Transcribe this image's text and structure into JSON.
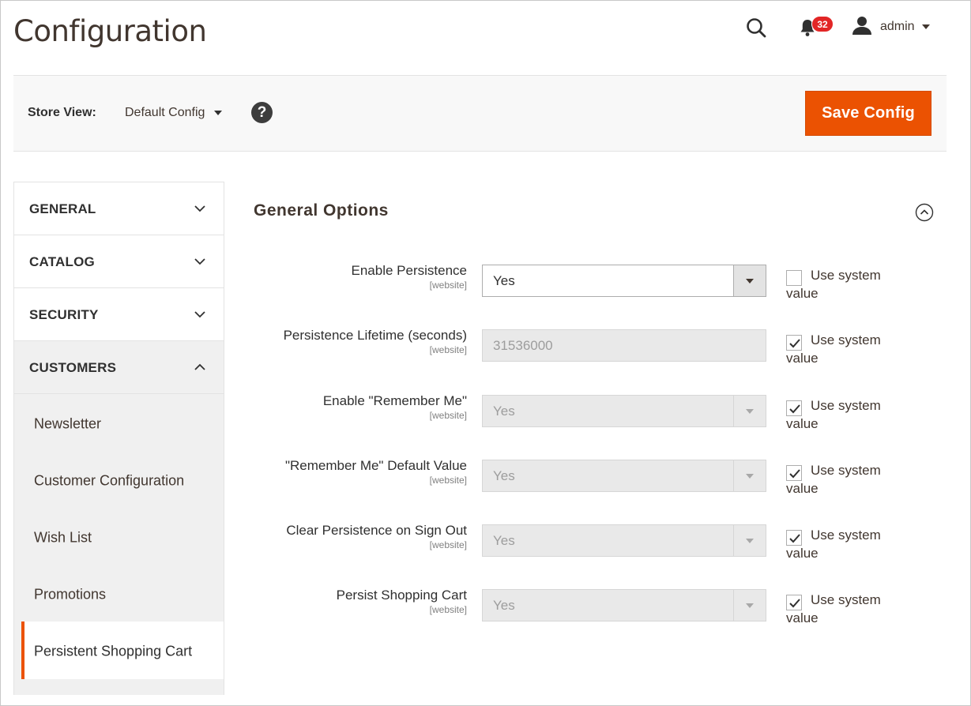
{
  "header": {
    "title": "Configuration",
    "notifications_count": "32",
    "user_label": "admin"
  },
  "store_bar": {
    "label": "Store View:",
    "selected": "Default Config",
    "help_glyph": "?",
    "save_label": "Save Config"
  },
  "sidebar": {
    "sections": [
      {
        "label": "GENERAL",
        "expanded": false
      },
      {
        "label": "CATALOG",
        "expanded": false
      },
      {
        "label": "SECURITY",
        "expanded": false
      },
      {
        "label": "CUSTOMERS",
        "expanded": true
      }
    ],
    "customer_items": [
      {
        "label": "Newsletter"
      },
      {
        "label": "Customer Configuration"
      },
      {
        "label": "Wish List"
      },
      {
        "label": "Promotions"
      },
      {
        "label": "Persistent Shopping Cart",
        "active": true
      }
    ]
  },
  "main": {
    "section_title": "General Options",
    "use_system_line1": "Use system",
    "use_system_line2": "value",
    "fields": [
      {
        "label": "Enable Persistence",
        "scope": "[website]",
        "value": "Yes",
        "type": "select",
        "disabled": false,
        "use_system": false
      },
      {
        "label": "Persistence Lifetime (seconds)",
        "scope": "[website]",
        "value": "31536000",
        "type": "text",
        "disabled": true,
        "use_system": true
      },
      {
        "label": "Enable \"Remember Me\"",
        "scope": "[website]",
        "value": "Yes",
        "type": "select",
        "disabled": true,
        "use_system": true
      },
      {
        "label": "\"Remember Me\" Default Value",
        "scope": "[website]",
        "value": "Yes",
        "type": "select",
        "disabled": true,
        "use_system": true
      },
      {
        "label": "Clear Persistence on Sign Out",
        "scope": "[website]",
        "value": "Yes",
        "type": "select",
        "disabled": true,
        "use_system": true
      },
      {
        "label": "Persist Shopping Cart",
        "scope": "[website]",
        "value": "Yes",
        "type": "select",
        "disabled": true,
        "use_system": true
      }
    ]
  },
  "colors": {
    "accent": "#eb5202",
    "badge": "#e22626",
    "text": "#303030"
  },
  "icons": {
    "search": "search-icon",
    "notifications": "bell-icon",
    "user": "user-icon",
    "collapse": "chevron-up-circle-icon",
    "section_chevron": "chevron-down-icon"
  }
}
